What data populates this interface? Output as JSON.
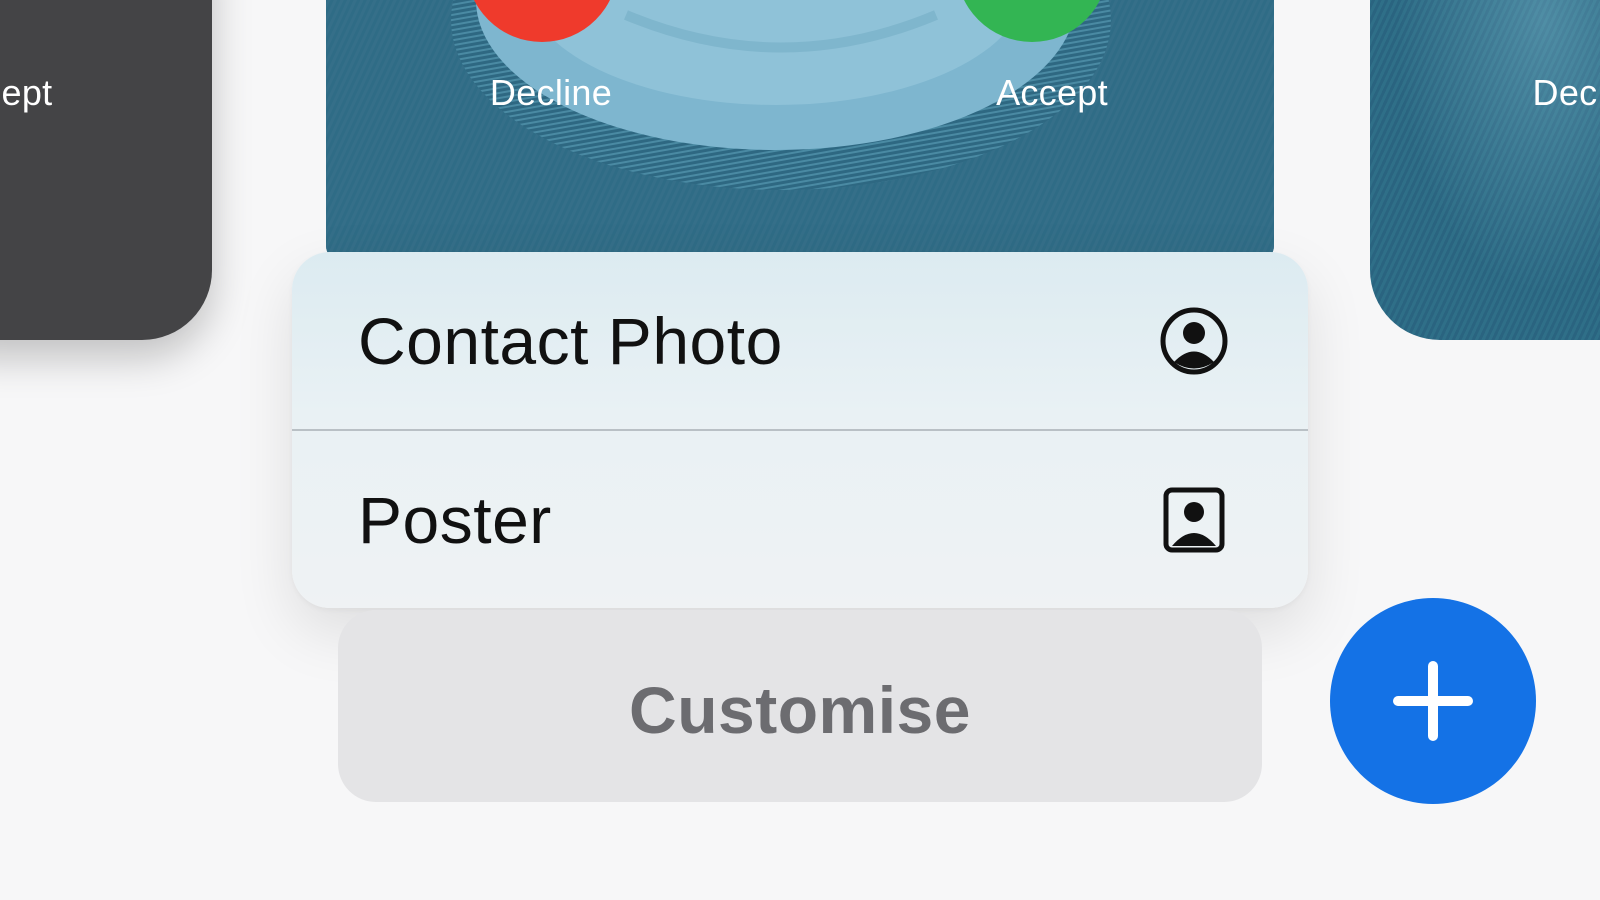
{
  "left_preview": {
    "accept_label": "ept"
  },
  "poster_preview": {
    "decline_label": "Decline",
    "accept_label": "Accept"
  },
  "right_preview": {
    "decline_label": "Dec"
  },
  "menu": {
    "items": [
      {
        "label": "Contact Photo",
        "icon": "person-circle-icon"
      },
      {
        "label": "Poster",
        "icon": "person-rectangle-icon"
      }
    ]
  },
  "customise": {
    "label": "Customise"
  },
  "add_button": {
    "icon": "plus-icon"
  },
  "colors": {
    "decline": "#ef3a2c",
    "accept": "#33b553",
    "add_button": "#1472e6"
  }
}
